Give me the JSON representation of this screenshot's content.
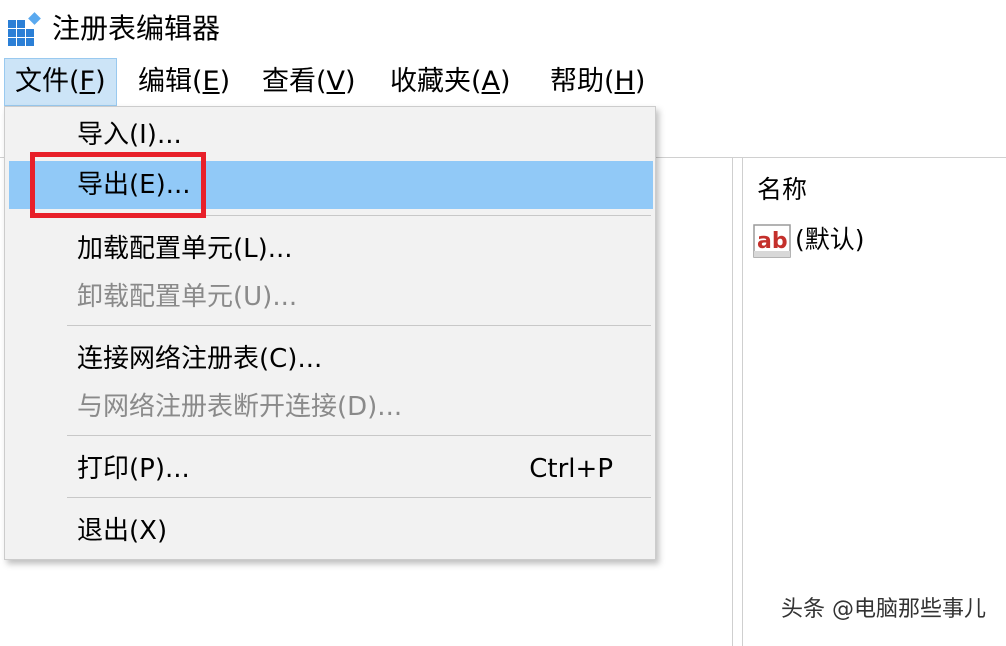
{
  "window": {
    "title": "注册表编辑器",
    "app_icon": "registry-icon"
  },
  "menubar": {
    "items": [
      {
        "label": "文件(",
        "accel": "F",
        "tail": ")"
      },
      {
        "label": "编辑(",
        "accel": "E",
        "tail": ")"
      },
      {
        "label": "查看(",
        "accel": "V",
        "tail": ")"
      },
      {
        "label": "收藏夹(",
        "accel": "A",
        "tail": ")"
      },
      {
        "label": "帮助(",
        "accel": "H",
        "tail": ")"
      }
    ]
  },
  "file_menu": {
    "items": [
      {
        "label": "导入(I)...",
        "enabled": true
      },
      {
        "label": "导出(E)...",
        "enabled": true,
        "highlighted": true
      },
      {
        "label": "加载配置单元(L)...",
        "enabled": true
      },
      {
        "label": "卸载配置单元(U)...",
        "enabled": false
      },
      {
        "label": "连接网络注册表(C)...",
        "enabled": true
      },
      {
        "label": "与网络注册表断开连接(D)...",
        "enabled": false
      },
      {
        "label": "打印(P)...",
        "enabled": true,
        "shortcut": "Ctrl+P"
      },
      {
        "label": "退出(X)",
        "enabled": true
      }
    ]
  },
  "list_pane": {
    "column_name": "名称",
    "values": [
      {
        "icon": "string-value-icon",
        "icon_text": "ab",
        "name": "(默认)"
      }
    ]
  },
  "watermark": "头条 @电脑那些事儿",
  "colors": {
    "menu_highlight": "#91c9f7",
    "menu_open_bg": "#cce4f7",
    "annotation": "#e8202a",
    "disabled_text": "#8a8a8a"
  }
}
